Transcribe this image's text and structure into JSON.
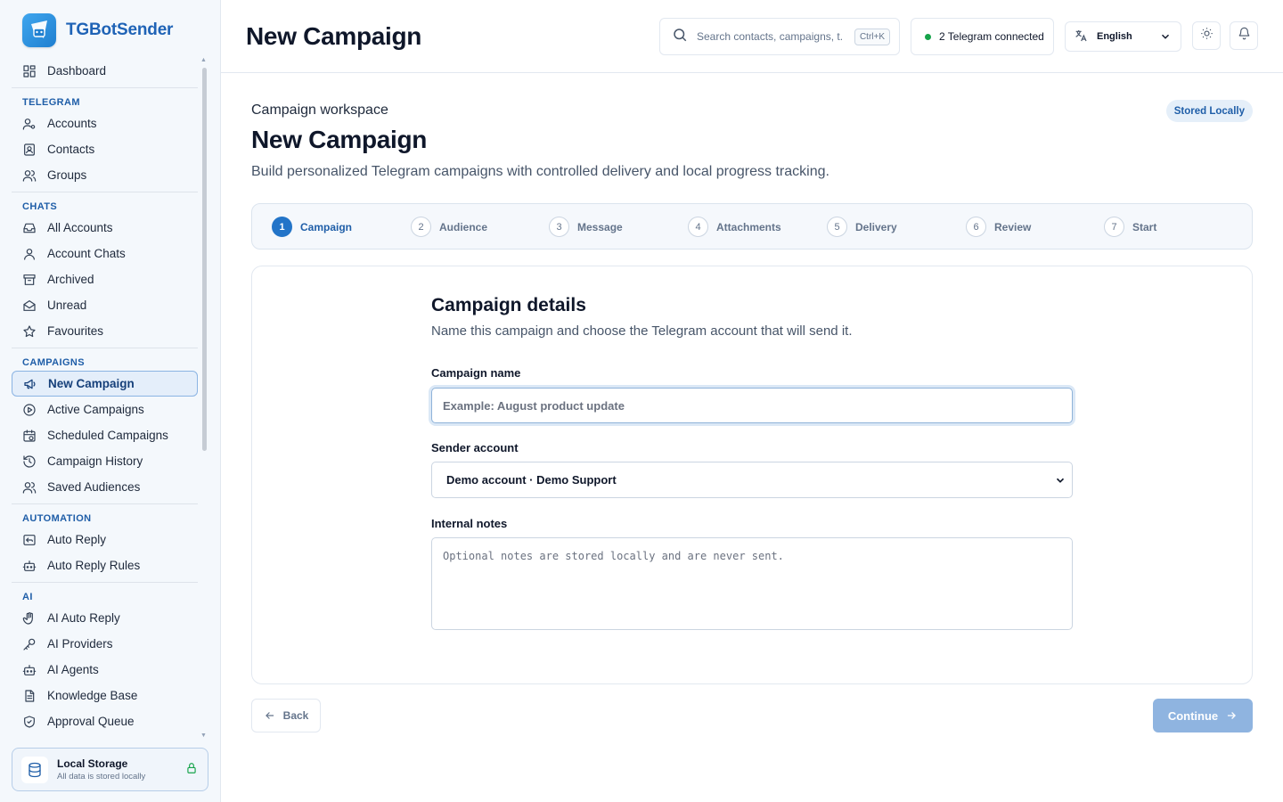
{
  "brand": {
    "name": "TGBotSender"
  },
  "sidebar": {
    "sections": [
      {
        "title": "",
        "items": [
          {
            "label": "Dashboard",
            "icon": "dashboard-icon"
          }
        ]
      },
      {
        "title": "TELEGRAM",
        "items": [
          {
            "label": "Accounts",
            "icon": "user-cog-icon"
          },
          {
            "label": "Contacts",
            "icon": "contact-book-icon"
          },
          {
            "label": "Groups",
            "icon": "users-icon"
          }
        ]
      },
      {
        "title": "CHATS",
        "items": [
          {
            "label": "All Accounts",
            "icon": "inbox-icon"
          },
          {
            "label": "Account Chats",
            "icon": "user-icon"
          },
          {
            "label": "Archived",
            "icon": "archive-icon"
          },
          {
            "label": "Unread",
            "icon": "mail-open-icon"
          },
          {
            "label": "Favourites",
            "icon": "star-icon"
          }
        ]
      },
      {
        "title": "CAMPAIGNS",
        "items": [
          {
            "label": "New Campaign",
            "icon": "megaphone-icon",
            "active": true
          },
          {
            "label": "Active Campaigns",
            "icon": "play-circle-icon"
          },
          {
            "label": "Scheduled Campaigns",
            "icon": "calendar-clock-icon"
          },
          {
            "label": "Campaign History",
            "icon": "history-icon"
          },
          {
            "label": "Saved Audiences",
            "icon": "users-icon"
          }
        ]
      },
      {
        "title": "AUTOMATION",
        "items": [
          {
            "label": "Auto Reply",
            "icon": "reply-icon"
          },
          {
            "label": "Auto Reply Rules",
            "icon": "bot-icon"
          }
        ]
      },
      {
        "title": "AI",
        "items": [
          {
            "label": "AI Auto Reply",
            "icon": "hand-icon"
          },
          {
            "label": "AI Providers",
            "icon": "key-icon"
          },
          {
            "label": "AI Agents",
            "icon": "bot-icon"
          },
          {
            "label": "Knowledge Base",
            "icon": "document-icon"
          },
          {
            "label": "Approval Queue",
            "icon": "shield-check-icon"
          }
        ]
      }
    ],
    "storage": {
      "title": "Local Storage",
      "subtitle": "All data is stored locally"
    }
  },
  "topbar": {
    "title": "New Campaign",
    "search_placeholder": "Search contacts, campaigns, t...",
    "search_shortcut": "Ctrl+K",
    "status_text": "2 Telegram connected",
    "language": "English"
  },
  "page": {
    "eyebrow": "Campaign workspace",
    "badge": "Stored Locally",
    "title": "New Campaign",
    "subtitle": "Build personalized Telegram campaigns with controlled delivery and local progress tracking."
  },
  "steps": [
    {
      "num": "1",
      "label": "Campaign",
      "active": true
    },
    {
      "num": "2",
      "label": "Audience"
    },
    {
      "num": "3",
      "label": "Message"
    },
    {
      "num": "4",
      "label": "Attachments"
    },
    {
      "num": "5",
      "label": "Delivery"
    },
    {
      "num": "6",
      "label": "Review"
    },
    {
      "num": "7",
      "label": "Start"
    }
  ],
  "form": {
    "title": "Campaign details",
    "subtitle": "Name this campaign and choose the Telegram account that will send it.",
    "name_label": "Campaign name",
    "name_value": "",
    "name_placeholder": "Example: August product update",
    "sender_label": "Sender account",
    "sender_value": "Demo account · Demo Support",
    "notes_label": "Internal notes",
    "notes_value": "",
    "notes_placeholder": "Optional notes are stored locally and are never sent."
  },
  "actions": {
    "back": "Back",
    "continue": "Continue"
  },
  "colors": {
    "accent": "#2374c8",
    "brand": "#1f63b6",
    "success": "#16a34a",
    "continue_disabled": "#8fb4e0"
  }
}
